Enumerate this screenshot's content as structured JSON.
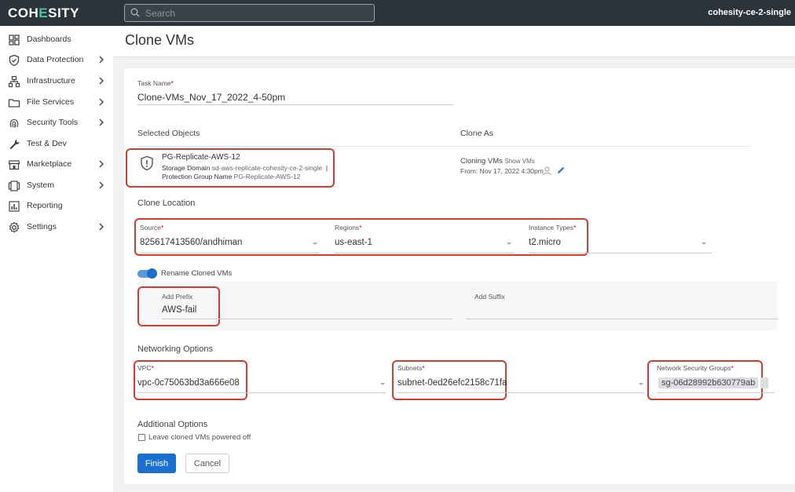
{
  "topbar": {
    "logo_pre": "COH",
    "logo_accent": "E",
    "logo_post": "SITY",
    "search_placeholder": "Search",
    "cluster_name": "cohesity-ce-2-single"
  },
  "sidebar": {
    "items": [
      {
        "label": "Dashboards",
        "icon": "dashboard-icon",
        "has_submenu": false
      },
      {
        "label": "Data Protection",
        "icon": "shield-icon",
        "has_submenu": true
      },
      {
        "label": "Infrastructure",
        "icon": "infrastructure-icon",
        "has_submenu": true
      },
      {
        "label": "File Services",
        "icon": "folder-icon",
        "has_submenu": true
      },
      {
        "label": "Security Tools",
        "icon": "fingerprint-icon",
        "has_submenu": true
      },
      {
        "label": "Test & Dev",
        "icon": "wrench-icon",
        "has_submenu": false
      },
      {
        "label": "Marketplace",
        "icon": "store-icon",
        "has_submenu": true
      },
      {
        "label": "System",
        "icon": "system-icon",
        "has_submenu": true
      },
      {
        "label": "Reporting",
        "icon": "report-icon",
        "has_submenu": false
      },
      {
        "label": "Settings",
        "icon": "gear-icon",
        "has_submenu": true
      }
    ]
  },
  "page": {
    "title": "Clone VMs"
  },
  "form": {
    "task_name_label": "Task Name",
    "task_name_value": "Clone-VMs_Nov_17_2022_4-50pm",
    "selected_objects_heading": "Selected Objects",
    "clone_as_heading": "Clone As",
    "object": {
      "name": "PG-Replicate-AWS-12",
      "storage_domain_label": "Storage Domain",
      "storage_domain_value": "sd-aws-replicate-cohesity-ce-2-single",
      "separator": "|",
      "protection_group_label": "Protection Group Name",
      "protection_group_value": "PG-Replicate-AWS-12"
    },
    "clone_as": {
      "text": "Cloning VMs",
      "show_link": "Show VMs",
      "from_text": "From: Nov 17, 2022 4:30pm"
    },
    "clone_location_heading": "Clone Location",
    "source_label": "Source",
    "source_value": "825617413560/andhiman",
    "regions_label": "Regions",
    "regions_value": "us-east-1",
    "instance_types_label": "Instance Types",
    "instance_types_value": "t2.micro",
    "rename_toggle_label": "Rename Cloned VMs",
    "rename_enabled": true,
    "add_prefix_label": "Add Prefix",
    "add_prefix_value": "AWS-fail",
    "add_suffix_label": "Add Suffix",
    "add_suffix_value": "",
    "networking_heading": "Networking Options",
    "vpc_label": "VPC",
    "vpc_value": "vpc-0c75063bd3a666e08",
    "subnets_label": "Subnets",
    "subnets_value": "subnet-0ed26efc2158c71fa",
    "nsg_label": "Network Security Groups",
    "nsg_chip": "sg-06d28992b630779ab",
    "additional_heading": "Additional Options",
    "leave_powered_off_label": "Leave cloned VMs powered off",
    "leave_powered_off_checked": false,
    "required_marker": "*",
    "finish_label": "Finish",
    "cancel_label": "Cancel"
  },
  "colors": {
    "topbar_bg": "#2b333b",
    "accent_green": "#3ec9a0",
    "primary_blue": "#1a6fcf",
    "required_red": "#d0021b",
    "annotation_red": "#d93a2b"
  }
}
